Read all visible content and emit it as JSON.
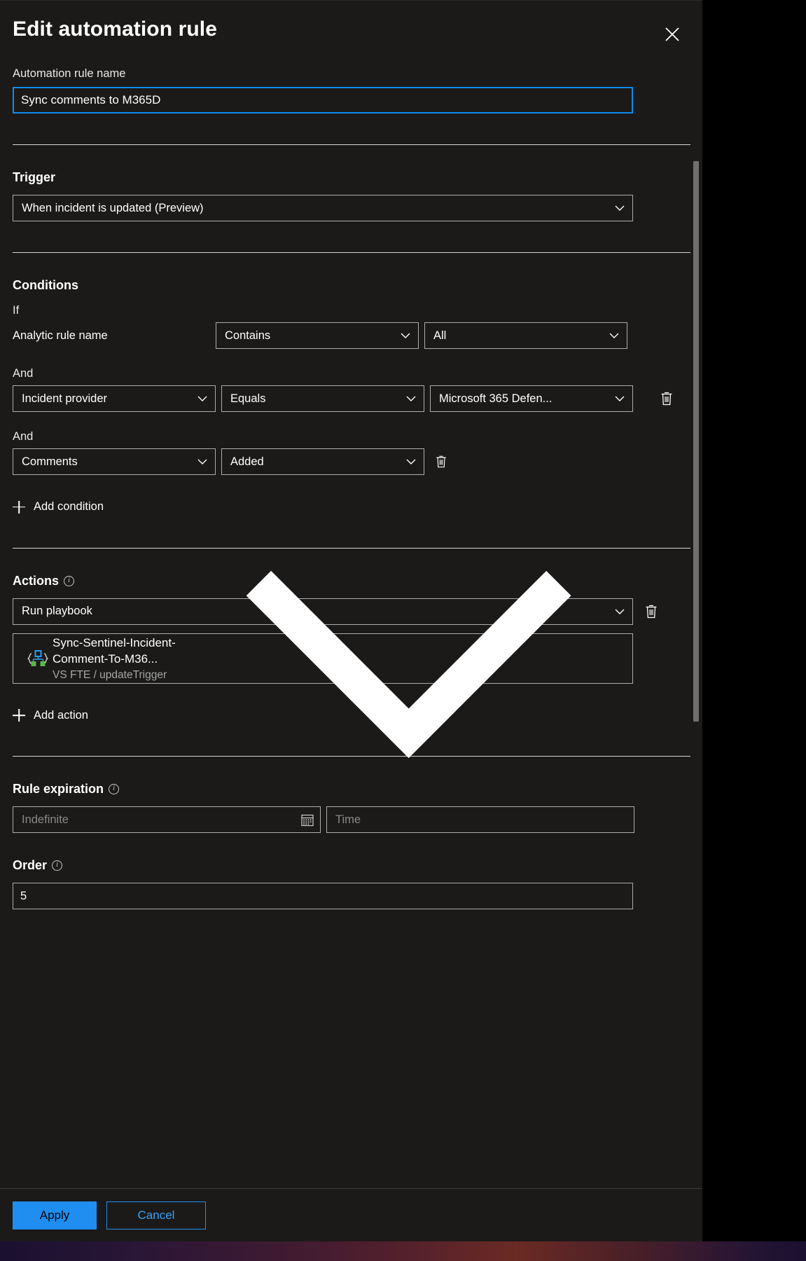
{
  "blade": {
    "title": "Edit automation rule",
    "close_icon": "close-icon"
  },
  "name_field": {
    "label": "Automation rule name",
    "value": "Sync comments to M365D",
    "placeholder": "Automation rule name"
  },
  "trigger": {
    "heading": "Trigger",
    "value": "When incident is updated (Preview)"
  },
  "conditions": {
    "heading": "Conditions",
    "if_label": "If",
    "and_label": "And",
    "add_condition_label": "Add condition",
    "rows": [
      {
        "conjunction": "If",
        "property_static": "Analytic rule name",
        "property": "Analytic rule name",
        "operator": "Contains",
        "value": "All",
        "has_delete": false,
        "static_property": true
      },
      {
        "conjunction": "And",
        "property": "Incident provider",
        "operator": "Equals",
        "value": "Microsoft 365 Defen...",
        "has_delete": true,
        "static_property": false
      },
      {
        "conjunction": "And",
        "property": "Comments",
        "operator": "Added",
        "value": "",
        "has_delete": true,
        "static_property": false
      }
    ]
  },
  "actions": {
    "heading": "Actions",
    "info_icon": "info-icon",
    "action_type": "Run playbook",
    "playbook": {
      "name": "Sync-Sentinel-Incident-Comment-To-M36...",
      "subtitle": "VS FTE / updateTrigger",
      "icon": "logic-app-icon"
    },
    "add_action_label": "Add action"
  },
  "rule_expiration": {
    "heading": "Rule expiration",
    "date_placeholder": "Indefinite",
    "time_placeholder": "Time",
    "calendar_icon": "calendar-icon"
  },
  "order": {
    "heading": "Order",
    "value": "5"
  },
  "footer": {
    "apply_label": "Apply",
    "cancel_label": "Cancel"
  },
  "colors": {
    "accent": "#1f8ef0",
    "panel_bg": "#1b1a19",
    "border": "#adadad",
    "focus_border": "#0f8bf0"
  }
}
